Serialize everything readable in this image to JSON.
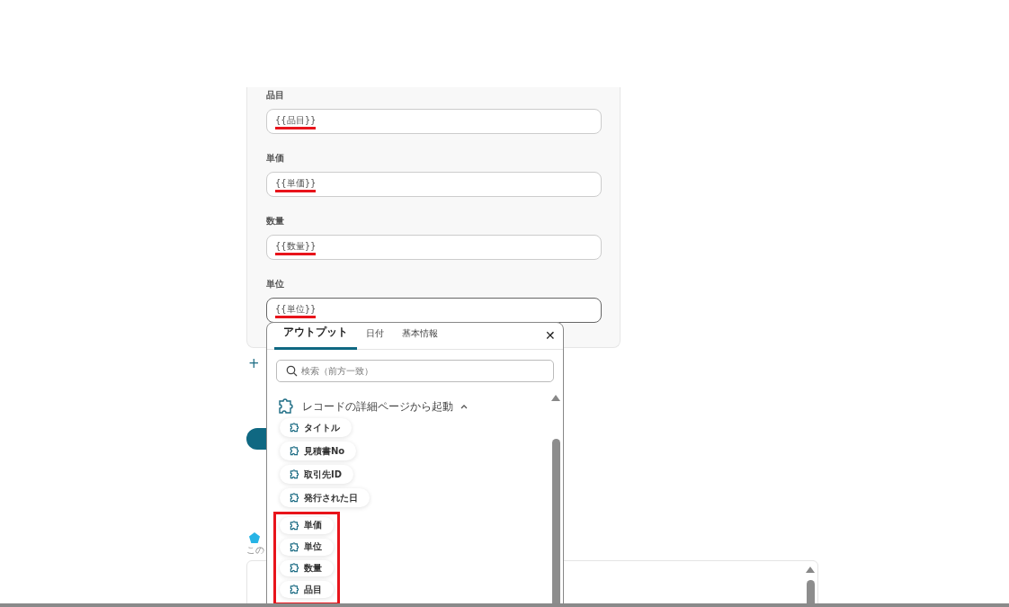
{
  "form_fields": [
    {
      "label": "品目",
      "value": "{{品目}}",
      "underlined": true,
      "focused": false
    },
    {
      "label": "単価",
      "value": "{{単価}}",
      "underlined": true,
      "focused": false
    },
    {
      "label": "数量",
      "value": "{{数量}}",
      "underlined": true,
      "focused": false
    },
    {
      "label": "単位",
      "value": "{{単位}}",
      "underlined": true,
      "focused": true
    }
  ],
  "add_link": {
    "label": "+"
  },
  "note": {
    "text": "この"
  },
  "output_popup": {
    "tabs": [
      {
        "label": "アウトプット",
        "selected": true
      },
      {
        "label": "日付",
        "selected": false
      },
      {
        "label": "基本情報",
        "selected": false
      }
    ],
    "close": "✕",
    "search": {
      "placeholder": "検索（前方一致）"
    },
    "group": {
      "title": "レコードの詳細ページから起動",
      "expanded": true,
      "items": [
        {
          "label": "タイトル"
        },
        {
          "label": "見積書No"
        },
        {
          "label": "取引先ID"
        },
        {
          "label": "発行された日"
        }
      ],
      "highlighted_items": [
        {
          "label": "単価"
        },
        {
          "label": "単位"
        },
        {
          "label": "数量"
        },
        {
          "label": "品目"
        }
      ]
    }
  }
}
